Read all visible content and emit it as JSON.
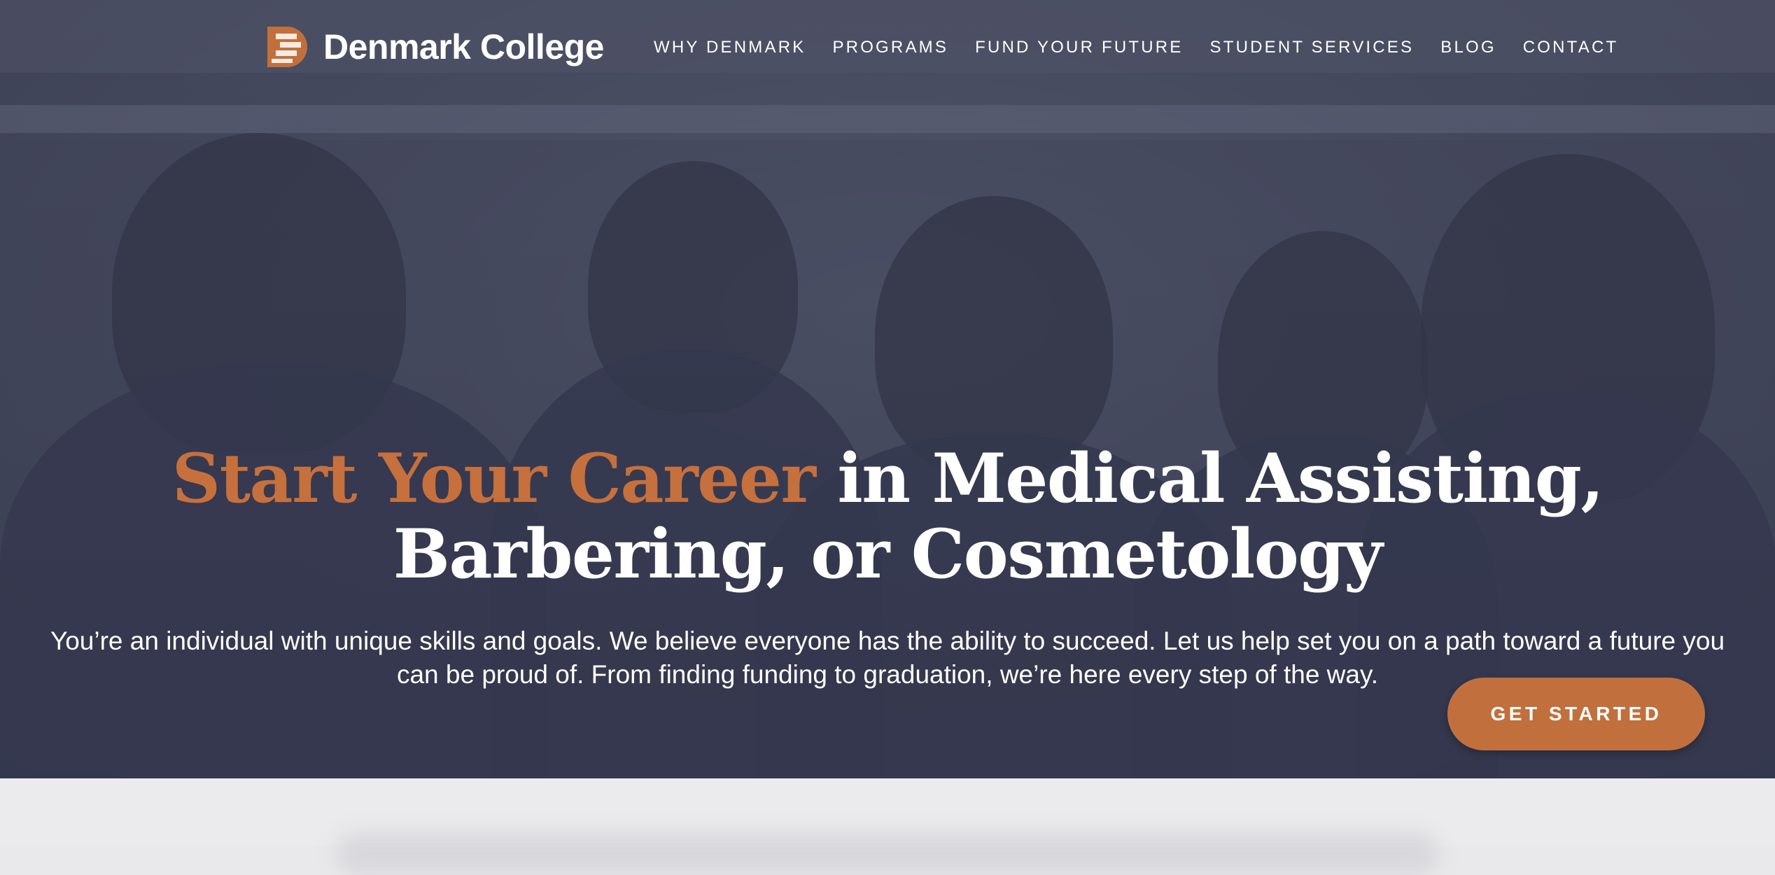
{
  "brand": {
    "name": "Denmark College",
    "logo_icon": "denmark-college-d-logo",
    "accent_color": "#c1703d",
    "overlay_color": "#474b60"
  },
  "nav": {
    "items": [
      {
        "label": "WHY DENMARK"
      },
      {
        "label": "PROGRAMS"
      },
      {
        "label": "FUND YOUR FUTURE"
      },
      {
        "label": "STUDENT SERVICES"
      },
      {
        "label": "BLOG"
      },
      {
        "label": "CONTACT"
      }
    ]
  },
  "hero": {
    "headline_accent": "Start Your Career",
    "headline_rest_line1": " in Medical Assisting,",
    "headline_line2": "Barbering, or Cosmetology",
    "subtext": "You’re an individual with unique skills and goals. We believe everyone has the ability to succeed. Let us help set you on a path toward a future you can be proud of. From finding funding to graduation, we’re here every step of the way.",
    "cta_label": "GET STARTED"
  }
}
